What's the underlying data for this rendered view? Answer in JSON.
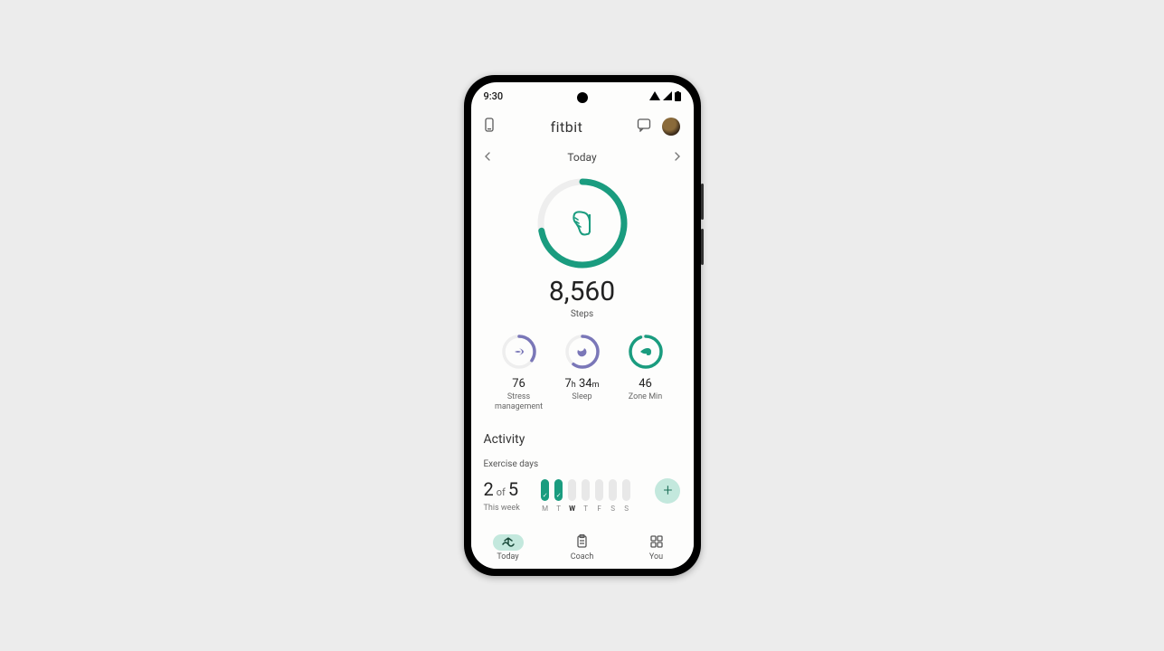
{
  "status": {
    "time": "9:30"
  },
  "app": {
    "title": "fitbit"
  },
  "dateNav": {
    "label": "Today"
  },
  "hero": {
    "value": "8,560",
    "label": "Steps",
    "progress": 0.72,
    "color": "#1a9c7f"
  },
  "metrics": [
    {
      "id": "stress",
      "value": "76",
      "label": "Stress management",
      "progress": 0.35,
      "color": "#7a77b8",
      "icon": "spa"
    },
    {
      "id": "sleep",
      "value_h": "7",
      "value_m": "34",
      "label": "Sleep",
      "progress": 0.6,
      "color": "#7a77b8",
      "icon": "moon"
    },
    {
      "id": "zone",
      "value": "46",
      "label": "Zone Min",
      "progress": 0.95,
      "color": "#1a9c7f",
      "icon": "flame"
    }
  ],
  "section": {
    "activity": "Activity",
    "exerciseDays": "Exercise days"
  },
  "exercise": {
    "done": "2",
    "of": "of",
    "goal": "5",
    "sub": "This week",
    "days": [
      {
        "l": "M",
        "done": true
      },
      {
        "l": "T",
        "done": true
      },
      {
        "l": "W",
        "done": false,
        "current": true
      },
      {
        "l": "T",
        "done": false
      },
      {
        "l": "F",
        "done": false
      },
      {
        "l": "S",
        "done": false
      },
      {
        "l": "S",
        "done": false
      }
    ]
  },
  "nav": [
    {
      "id": "today",
      "label": "Today",
      "active": true
    },
    {
      "id": "coach",
      "label": "Coach",
      "active": false
    },
    {
      "id": "you",
      "label": "You",
      "active": false
    }
  ]
}
